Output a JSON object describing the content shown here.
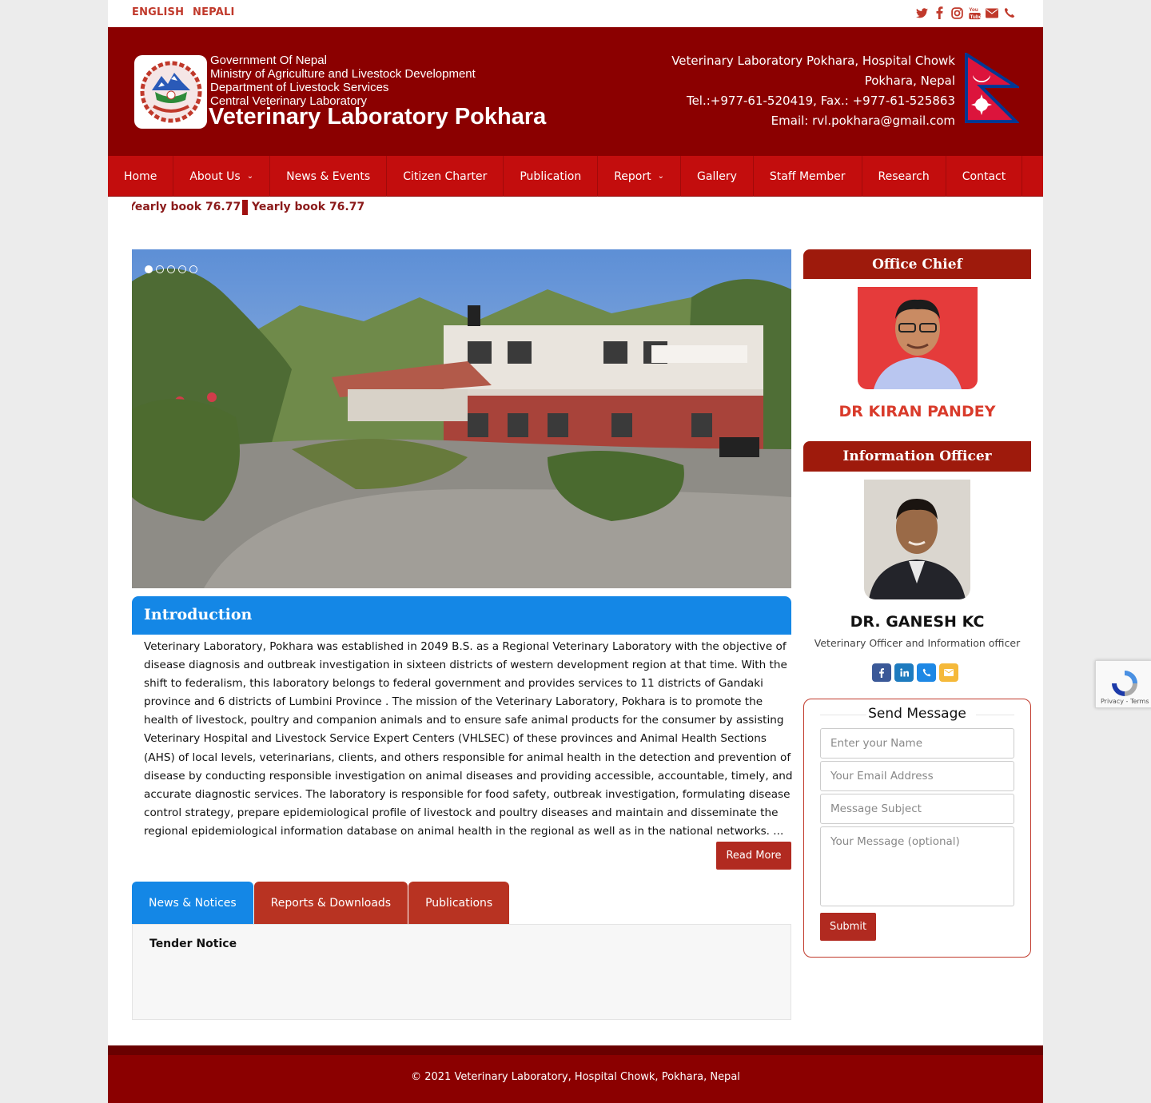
{
  "topbar": {
    "lang_english": "ENGLISH",
    "lang_nepali": "NEPALI",
    "social_icons": [
      "twitter-icon",
      "facebook-icon",
      "instagram-icon",
      "youtube-icon",
      "envelope-icon",
      "phone-icon"
    ],
    "accent": "#c0392b"
  },
  "header": {
    "gov_lines": [
      "Government Of Nepal",
      "Ministry of Agriculture and Livestock Development",
      "Department of Livestock Services",
      "Central Veterinary Laboratory"
    ],
    "site_title": "Veterinary Laboratory Pokhara",
    "address_line1": "Veterinary Laboratory Pokhara, Hospital Chowk",
    "address_line2": "Pokhara, Nepal",
    "tel_fax": "Tel.:+977-61-520419, Fax.: +977-61-525863",
    "email": "Email: rvl.pokhara@gmail.com",
    "bg_color": "#8b0000"
  },
  "nav": {
    "items": [
      {
        "label": "Home"
      },
      {
        "label": "About Us"
      },
      {
        "label": "News & Events"
      },
      {
        "label": "Citizen Charter"
      },
      {
        "label": "Publication"
      },
      {
        "label": "Report"
      },
      {
        "label": "Gallery"
      },
      {
        "label": "Staff Member"
      },
      {
        "label": "Research"
      },
      {
        "label": "Contact"
      }
    ],
    "color": "#c30d0d"
  },
  "ticker": {
    "item1": "Yearly book 76.77",
    "item2": "Yearly book 76.77"
  },
  "slider": {
    "dot_count": 5,
    "active_dot": 1
  },
  "intro": {
    "heading": "Introduction",
    "text": "Veterinary Laboratory, Pokhara was established in 2049 B.S. as a Regional Veterinary Laboratory with the objective of disease diagnosis and outbreak investigation in sixteen districts of western development region at that time. With the shift to federalism, this laboratory belongs to federal government and provides services to 11 districts of Gandaki province and 6 districts of Lumbini Province . The mission of the Veterinary Laboratory, Pokhara is to promote the health of livestock, poultry and companion animals and to ensure safe animal products for the consumer by assisting Veterinary Hospital and Livestock Service Expert Centers (VHLSEC) of these provinces and Animal Health Sections (AHS) of local levels, veterinarians, clients, and others responsible for animal health in the detection and prevention of disease by conducting responsible investigation on animal diseases and providing accessible, accountable, timely, and accurate diagnostic services. The laboratory is responsible for food safety, outbreak investigation, formulating disease control strategy, prepare epidemiological profile of livestock and poultry diseases and maintain and disseminate the regional epidemiological information database on animal health in the regional as well as in the national networks. ...",
    "read_more": "Read More",
    "head_color": "#1487e6"
  },
  "tabs": {
    "items": [
      "News & Notices",
      "Reports & Downloads",
      "Publications"
    ],
    "active": "News & Notices",
    "panel_item": "Tender Notice"
  },
  "office_chief": {
    "heading": "Office Chief",
    "name": "DR KIRAN PANDEY"
  },
  "info_officer": {
    "heading": "Information Officer",
    "name": "DR. GANESH KC",
    "role": "Veterinary Officer and Information officer",
    "icons": [
      "facebook-icon",
      "linkedin-icon",
      "phone-icon",
      "envelope-icon"
    ]
  },
  "message_form": {
    "title": "Send Message",
    "name_placeholder": "Enter your Name",
    "email_placeholder": "Your Email Address",
    "subject_placeholder": "Message Subject",
    "message_placeholder": "Your Message (optional)",
    "submit": "Submit"
  },
  "footer": {
    "text": "© 2021 Veterinary Laboratory, Hospital Chowk, Pokhara, Nepal"
  },
  "recaptcha": {
    "label": "Privacy - Terms"
  }
}
